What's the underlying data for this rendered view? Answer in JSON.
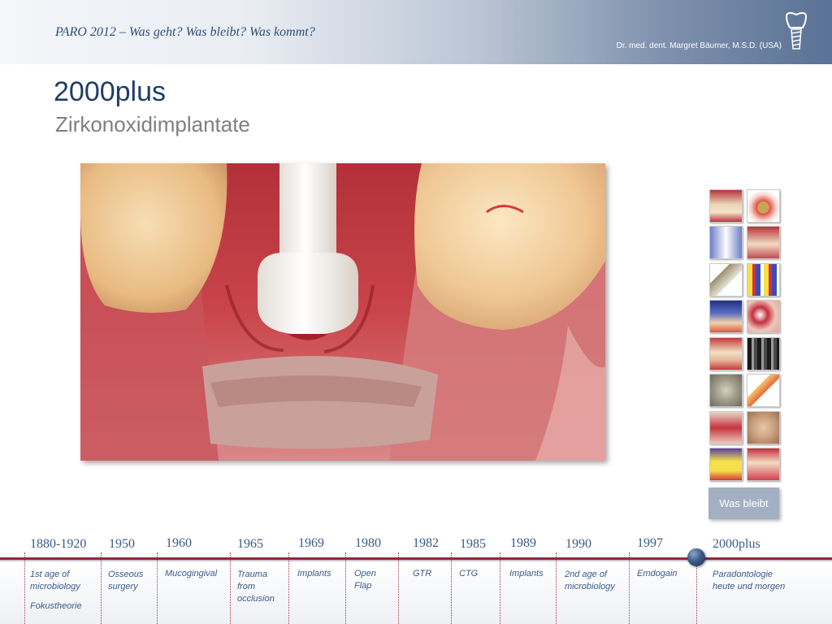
{
  "header": {
    "conference": "PARO 2012 – Was geht? Was bleibt? Was kommt?",
    "author": "Dr. med. dent. Margret Bäumer, M.S.D. (USA)"
  },
  "slide": {
    "title": "2000plus",
    "subtitle": "Zirkonoxidimplantate"
  },
  "nav_button": {
    "label": "Was bleibt"
  },
  "timeline": [
    {
      "year": "1880-1920",
      "lines": [
        "1st age of",
        "microbiology",
        "",
        "Fokustheorie"
      ]
    },
    {
      "year": "1950",
      "lines": [
        "Osseous",
        "surgery"
      ]
    },
    {
      "year": "1960",
      "lines": [
        "Mucogingival"
      ]
    },
    {
      "year": "1965",
      "lines": [
        "Trauma",
        "from",
        "occlusion"
      ]
    },
    {
      "year": "1969",
      "lines": [
        "Implants"
      ]
    },
    {
      "year": "1980",
      "lines": [
        "Open",
        "Flap"
      ]
    },
    {
      "year": "1982",
      "lines": [
        "GTR"
      ]
    },
    {
      "year": "1985",
      "lines": [
        "CTG"
      ]
    },
    {
      "year": "1989",
      "lines": [
        "Implants"
      ]
    },
    {
      "year": "1990",
      "lines": [
        "2nd age of",
        "microbiology"
      ]
    },
    {
      "year": "1997",
      "lines": [
        "Emdogain"
      ]
    },
    {
      "year": "2000plus",
      "lines": [
        "Paradontologie",
        "heute und morgen"
      ]
    }
  ],
  "colors": {
    "accent": "#8d2a3c",
    "text_blue": "#3a5a8a",
    "title_blue": "#1f3d66"
  },
  "icons": {
    "logo": "tooth-implant-icon",
    "timeline_marker": "timeline-knob-icon"
  }
}
